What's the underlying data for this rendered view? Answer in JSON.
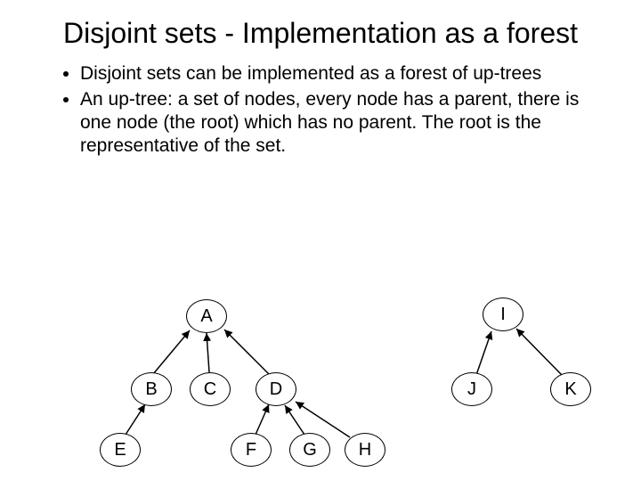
{
  "title": "Disjoint sets - Implementation as a forest",
  "bullets": [
    "Disjoint sets can be implemented as a forest of up-trees",
    "An up-tree: a set of nodes, every node has a parent, there is one node (the root) which has no parent. The root is the representative of the set."
  ],
  "nodes": {
    "A": "A",
    "B": "B",
    "C": "C",
    "D": "D",
    "E": "E",
    "F": "F",
    "G": "G",
    "H": "H",
    "I": "I",
    "J": "J",
    "K": "K"
  }
}
